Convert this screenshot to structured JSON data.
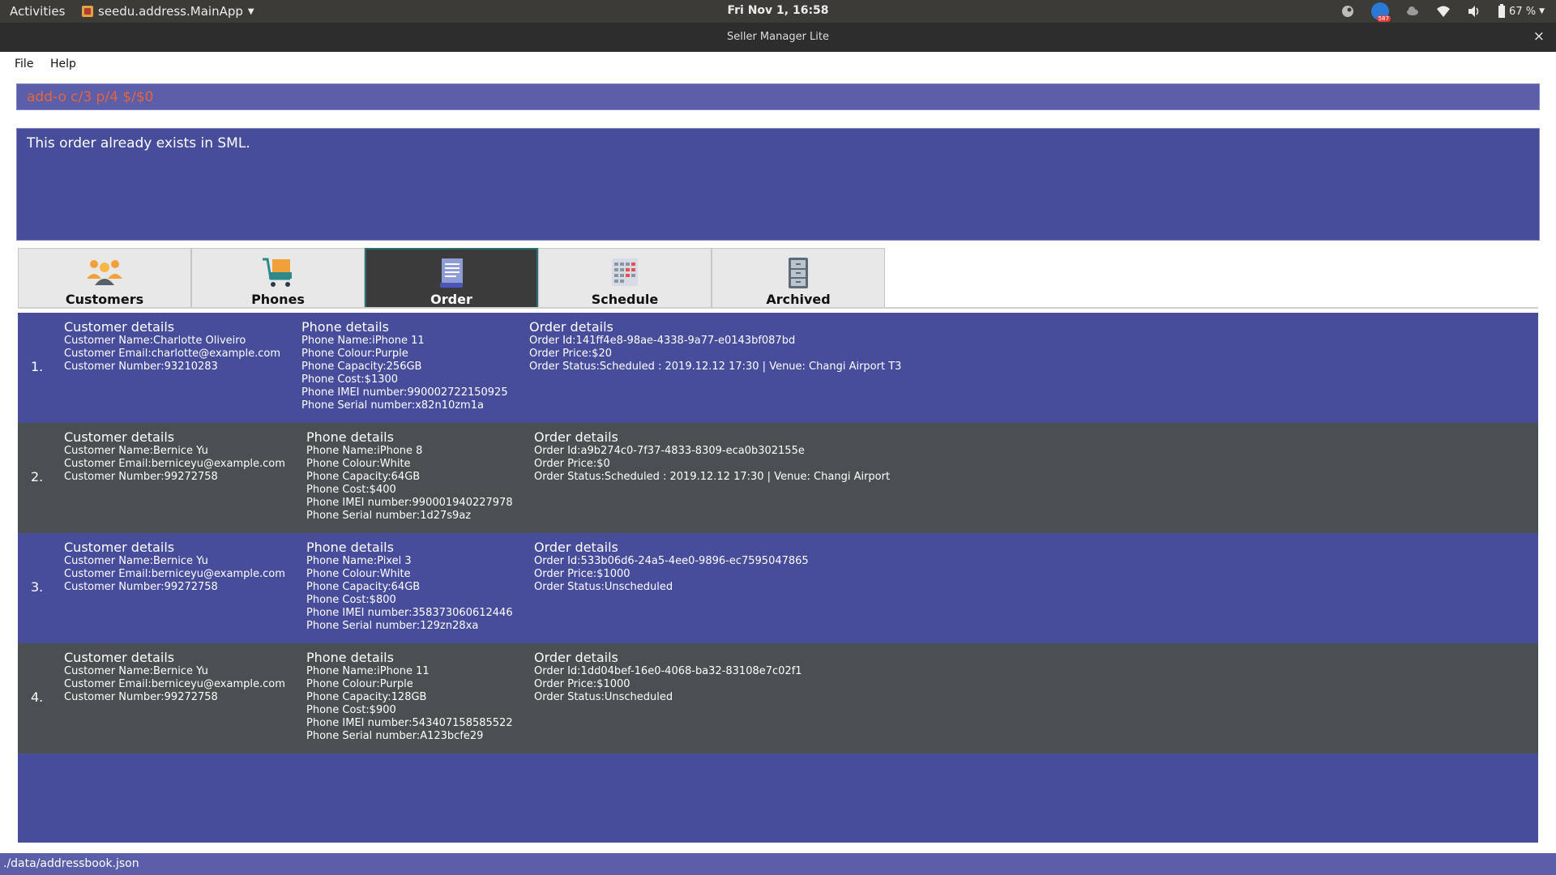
{
  "topbar": {
    "activities": "Activities",
    "app_menu": "seedu.address.MainApp",
    "clock": "Fri Nov  1, 16:58",
    "battery": "67 %"
  },
  "window": {
    "title": "Seller Manager Lite",
    "close": "×"
  },
  "menu": {
    "file": "File",
    "help": "Help"
  },
  "command": {
    "value": "add-o c/3 p/4 $/$0"
  },
  "result": {
    "message": "This order already exists in SML."
  },
  "tabs": [
    {
      "label": "Customers",
      "icon": "customers-icon",
      "active": false
    },
    {
      "label": "Phones",
      "icon": "cart-icon",
      "active": false
    },
    {
      "label": "Order",
      "icon": "order-icon",
      "active": true
    },
    {
      "label": "Schedule",
      "icon": "calendar-icon",
      "active": false
    },
    {
      "label": "Archived",
      "icon": "cabinet-icon",
      "active": false
    }
  ],
  "orders": [
    {
      "index": "1.",
      "customer": {
        "heading": "Customer details",
        "name": "Customer Name:Charlotte Oliveiro",
        "email": "Customer Email:charlotte@example.com",
        "number": "Customer Number:93210283"
      },
      "phone": {
        "heading": "Phone details",
        "name": "Phone Name:iPhone 11",
        "colour": "Phone Colour:Purple",
        "capacity": "Phone Capacity:256GB",
        "cost": "Phone Cost:$1300",
        "imei": "Phone IMEI number:990002722150925",
        "serial": "Phone Serial number:x82n10zm1a"
      },
      "order": {
        "heading": "Order details",
        "id": "Order Id:141ff4e8-98ae-4338-9a77-e0143bf087bd",
        "price": "Order Price:$20",
        "status": "Order Status:Scheduled : 2019.12.12 17:30 | Venue: Changi Airport T3"
      }
    },
    {
      "index": "2.",
      "customer": {
        "heading": "Customer details",
        "name": "Customer Name:Bernice Yu",
        "email": "Customer Email:berniceyu@example.com",
        "number": "Customer Number:99272758"
      },
      "phone": {
        "heading": "Phone details",
        "name": "Phone Name:iPhone 8",
        "colour": "Phone Colour:White",
        "capacity": "Phone Capacity:64GB",
        "cost": "Phone Cost:$400",
        "imei": "Phone IMEI number:990001940227978",
        "serial": "Phone Serial number:1d27s9az"
      },
      "order": {
        "heading": "Order details",
        "id": "Order Id:a9b274c0-7f37-4833-8309-eca0b302155e",
        "price": "Order Price:$0",
        "status": "Order Status:Scheduled : 2019.12.12 17:30 | Venue: Changi Airport"
      }
    },
    {
      "index": "3.",
      "customer": {
        "heading": "Customer details",
        "name": "Customer Name:Bernice Yu",
        "email": "Customer Email:berniceyu@example.com",
        "number": "Customer Number:99272758"
      },
      "phone": {
        "heading": "Phone details",
        "name": "Phone Name:Pixel 3",
        "colour": "Phone Colour:White",
        "capacity": "Phone Capacity:64GB",
        "cost": "Phone Cost:$800",
        "imei": "Phone IMEI number:358373060612446",
        "serial": "Phone Serial number:129zn28xa"
      },
      "order": {
        "heading": "Order details",
        "id": "Order Id:533b06d6-24a5-4ee0-9896-ec7595047865",
        "price": "Order Price:$1000",
        "status": "Order Status:Unscheduled"
      }
    },
    {
      "index": "4.",
      "customer": {
        "heading": "Customer details",
        "name": "Customer Name:Bernice Yu",
        "email": "Customer Email:berniceyu@example.com",
        "number": "Customer Number:99272758"
      },
      "phone": {
        "heading": "Phone details",
        "name": "Phone Name:iPhone 11",
        "colour": "Phone Colour:Purple",
        "capacity": "Phone Capacity:128GB",
        "cost": "Phone Cost:$900",
        "imei": "Phone IMEI number:543407158585522",
        "serial": "Phone Serial number:A123bcfe29"
      },
      "order": {
        "heading": "Order details",
        "id": "Order Id:1dd04bef-16e0-4068-ba32-83108e7c02f1",
        "price": "Order Price:$1000",
        "status": "Order Status:Unscheduled"
      }
    }
  ],
  "statusbar": {
    "path": "./data/addressbook.json"
  },
  "colors": {
    "accent_blue": "#484d9b",
    "row_grey": "#4a4f51",
    "command_text": "#e8643e"
  }
}
